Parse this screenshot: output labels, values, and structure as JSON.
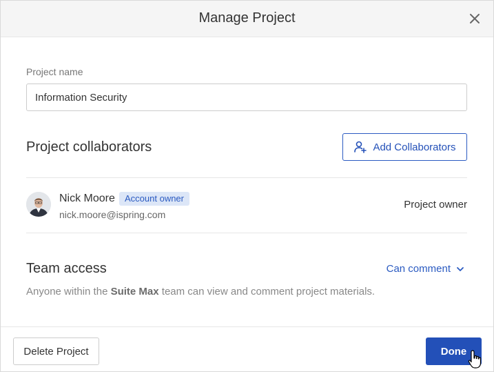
{
  "dialog": {
    "title": "Manage Project",
    "close_icon": "close-icon"
  },
  "project_name": {
    "label": "Project name",
    "value": "Information Security"
  },
  "collaborators": {
    "title": "Project collaborators",
    "add_button_label": "Add Collaborators",
    "add_icon": "add-user-icon",
    "items": [
      {
        "name": "Nick Moore",
        "badge": "Account owner",
        "email": "nick.moore@ispring.com",
        "role": "Project owner"
      }
    ]
  },
  "team_access": {
    "title": "Team access",
    "selected": "Can comment",
    "dropdown_icon": "chevron-down-icon",
    "description_prefix": "Anyone within the ",
    "team_name": "Suite Max",
    "description_suffix": " team can view and comment project materials."
  },
  "footer": {
    "delete_label": "Delete Project",
    "done_label": "Done"
  },
  "colors": {
    "accent": "#2350b8",
    "badge_bg": "#dce6f7",
    "header_bg": "#f5f5f5"
  }
}
